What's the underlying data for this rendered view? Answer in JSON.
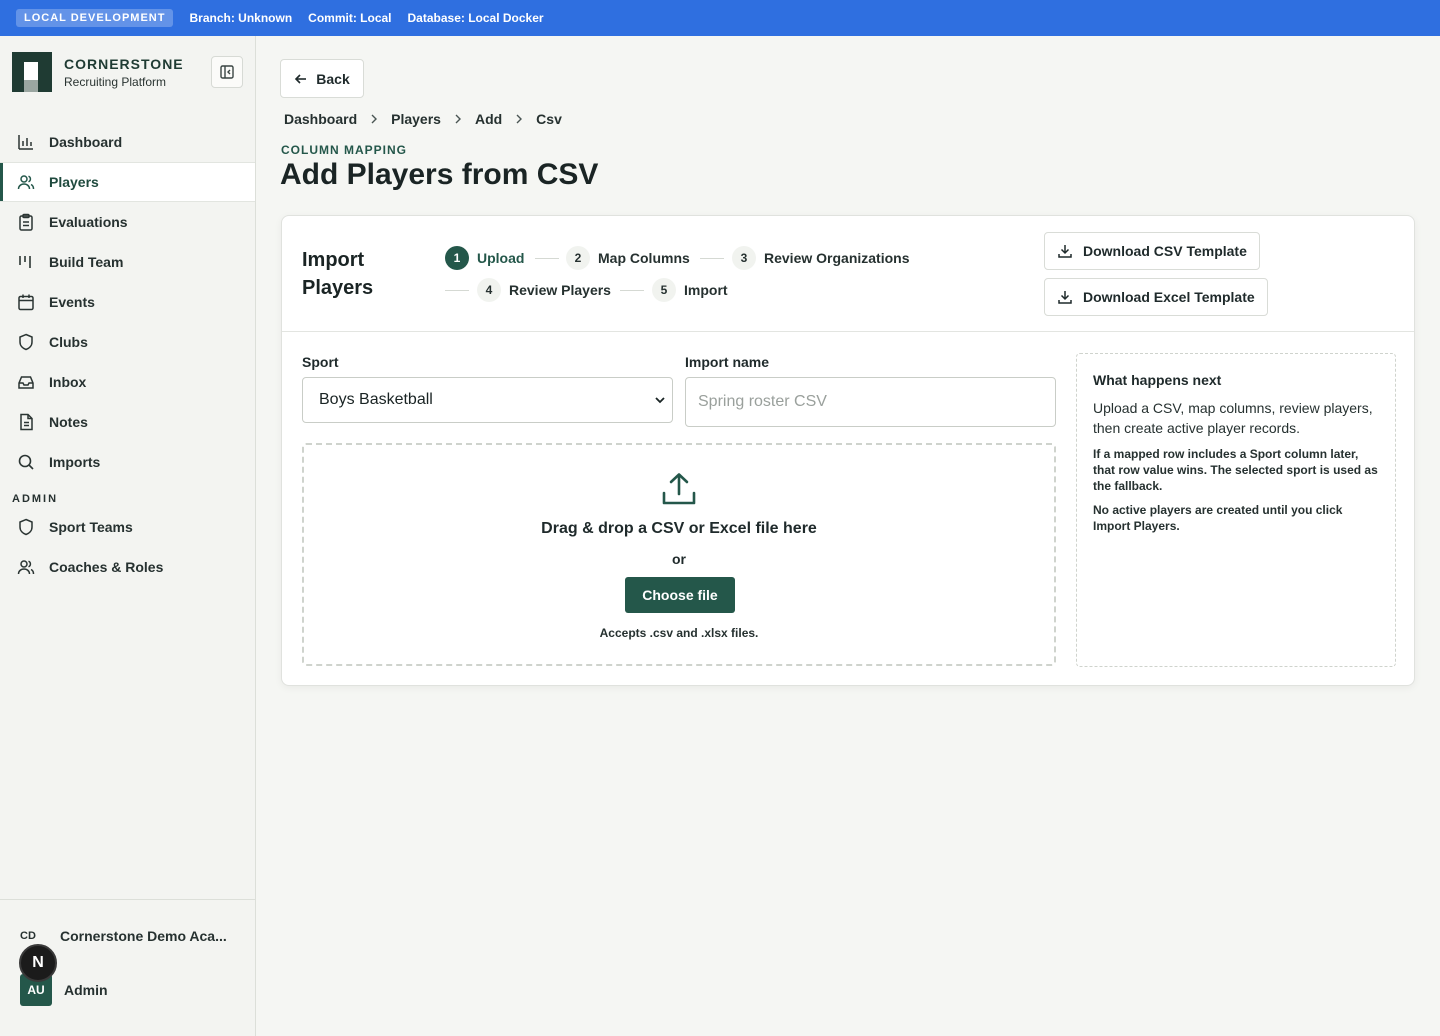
{
  "devbar": {
    "env_badge": "LOCAL DEVELOPMENT",
    "branch": "Branch: Unknown",
    "commit": "Commit: Local",
    "database": "Database: Local Docker"
  },
  "brand": {
    "name": "CORNERSTONE",
    "subtitle": "Recruiting Platform"
  },
  "nav": {
    "items": [
      {
        "label": "Dashboard",
        "icon": "bar-chart-icon"
      },
      {
        "label": "Players",
        "icon": "users-icon"
      },
      {
        "label": "Evaluations",
        "icon": "clipboard-icon"
      },
      {
        "label": "Build Team",
        "icon": "bars-icon"
      },
      {
        "label": "Events",
        "icon": "calendar-icon"
      },
      {
        "label": "Clubs",
        "icon": "shield-icon"
      },
      {
        "label": "Inbox",
        "icon": "inbox-icon"
      },
      {
        "label": "Notes",
        "icon": "document-icon"
      },
      {
        "label": "Imports",
        "icon": "search-icon"
      }
    ],
    "admin_section": "ADMIN",
    "admin_items": [
      {
        "label": "Sport Teams",
        "icon": "shield-icon"
      },
      {
        "label": "Coaches & Roles",
        "icon": "users-icon"
      }
    ],
    "active": "Players"
  },
  "footer": {
    "org_abbr": "CD",
    "org_name": "Cornerstone Demo Aca...",
    "user_initials": "AU",
    "user_name": "Admin",
    "overlay_badge": "N"
  },
  "header": {
    "back_label": "Back",
    "breadcrumb": [
      "Dashboard",
      "Players",
      "Add",
      "Csv"
    ],
    "eyebrow": "COLUMN MAPPING",
    "title": "Add Players from CSV"
  },
  "card": {
    "title": "Import Players",
    "steps": [
      {
        "num": "1",
        "label": "Upload"
      },
      {
        "num": "2",
        "label": "Map Columns"
      },
      {
        "num": "3",
        "label": "Review Organizations"
      },
      {
        "num": "4",
        "label": "Review Players"
      },
      {
        "num": "5",
        "label": "Import"
      }
    ],
    "active_step": 1,
    "download_csv": "Download CSV Template",
    "download_excel": "Download Excel Template",
    "sport_label": "Sport",
    "sport_value": "Boys Basketball",
    "import_name_label": "Import name",
    "import_name_placeholder": "Spring roster CSV",
    "import_name_value": "",
    "dropzone": {
      "title": "Drag & drop a CSV or Excel file here",
      "or": "or",
      "button": "Choose file",
      "note": "Accepts .csv and .xlsx files."
    },
    "next": {
      "title": "What happens next",
      "main": "Upload a CSV, map columns, review players, then create active player records.",
      "p1": "If a mapped row includes a Sport column later, that row value wins. The selected sport is used as the fallback.",
      "p2": "No active players are created until you click Import Players."
    }
  },
  "colors": {
    "banner": "#2f6fe0",
    "accent": "#24574a",
    "background": "#f5f6f3"
  }
}
